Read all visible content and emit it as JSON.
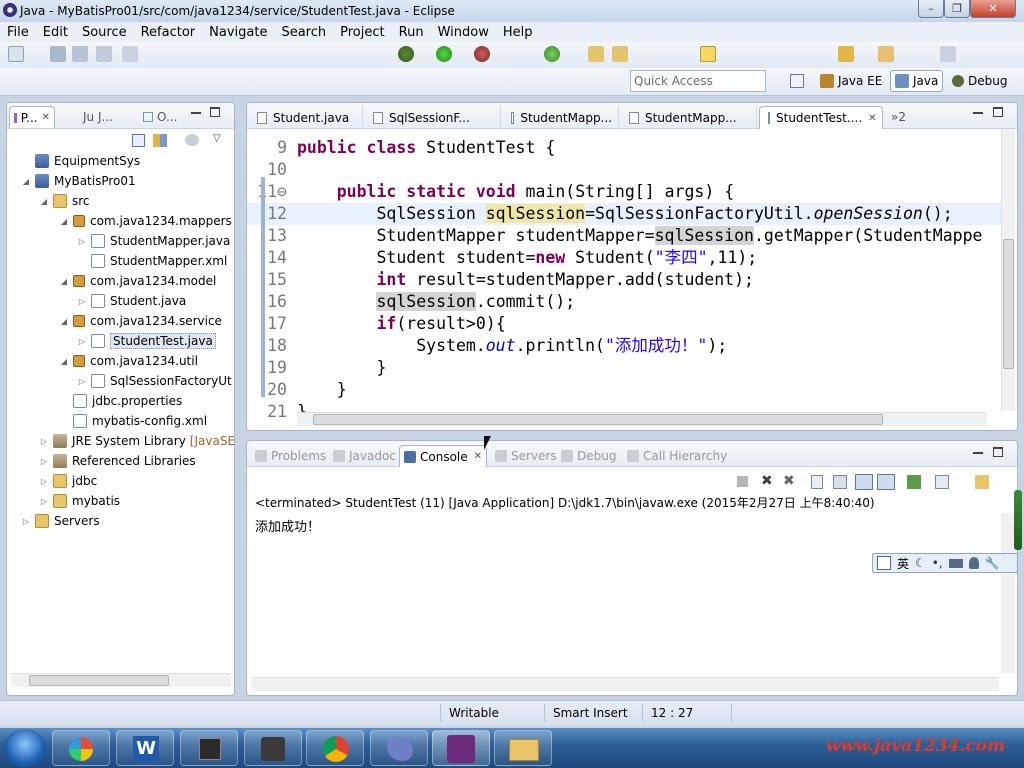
{
  "window": {
    "title": "Java - MyBatisPro01/src/com/java1234/service/StudentTest.java - Eclipse"
  },
  "menu": [
    "File",
    "Edit",
    "Source",
    "Refactor",
    "Navigate",
    "Search",
    "Project",
    "Run",
    "Window",
    "Help"
  ],
  "quick_access": {
    "placeholder": "Quick Access"
  },
  "perspectives": [
    {
      "label": "Java EE",
      "active": false
    },
    {
      "label": "Java",
      "active": true
    },
    {
      "label": "Debug",
      "active": false
    }
  ],
  "package_explorer": {
    "tabs": [
      "P...",
      "Ju J...",
      "O..."
    ],
    "tree": [
      {
        "label": "EquipmentSys",
        "icon": "project-icon",
        "level": 1,
        "twisty": ""
      },
      {
        "label": "MyBatisPro01",
        "icon": "project-icon",
        "level": 1,
        "twisty": "expanded"
      },
      {
        "label": "src",
        "icon": "source-folder-icon",
        "level": 2,
        "twisty": "expanded"
      },
      {
        "label": "com.java1234.mappers",
        "icon": "package-icon",
        "level": 3,
        "twisty": "expanded"
      },
      {
        "label": "StudentMapper.java",
        "icon": "java-file-icon",
        "level": 4,
        "twisty": "collapsed"
      },
      {
        "label": "StudentMapper.xml",
        "icon": "xml-file-icon",
        "level": 4,
        "twisty": ""
      },
      {
        "label": "com.java1234.model",
        "icon": "package-icon",
        "level": 3,
        "twisty": "expanded"
      },
      {
        "label": "Student.java",
        "icon": "java-file-icon",
        "level": 4,
        "twisty": "collapsed"
      },
      {
        "label": "com.java1234.service",
        "icon": "package-icon",
        "level": 3,
        "twisty": "expanded"
      },
      {
        "label": "StudentTest.java",
        "icon": "java-file-icon",
        "level": 4,
        "twisty": "collapsed",
        "selected": true
      },
      {
        "label": "com.java1234.util",
        "icon": "package-icon",
        "level": 3,
        "twisty": "expanded"
      },
      {
        "label": "SqlSessionFactoryUt",
        "icon": "java-file-icon",
        "level": 4,
        "twisty": "collapsed"
      },
      {
        "label": "jdbc.properties",
        "icon": "properties-file-icon",
        "level": 3,
        "twisty": ""
      },
      {
        "label": "mybatis-config.xml",
        "icon": "xml-file-icon",
        "level": 3,
        "twisty": ""
      },
      {
        "label": "JRE System Library",
        "suffix": "[JavaSE",
        "icon": "library-icon",
        "level": 2,
        "twisty": "collapsed"
      },
      {
        "label": "Referenced Libraries",
        "icon": "library-icon",
        "level": 2,
        "twisty": "collapsed"
      },
      {
        "label": "jdbc",
        "icon": "folder-icon",
        "level": 2,
        "twisty": "collapsed"
      },
      {
        "label": "mybatis",
        "icon": "folder-icon",
        "level": 2,
        "twisty": "collapsed"
      },
      {
        "label": "Servers",
        "icon": "folder-icon",
        "level": 1,
        "twisty": "collapsed"
      }
    ]
  },
  "editor": {
    "tabs": [
      {
        "label": "Student.java",
        "active": false
      },
      {
        "label": "SqlSessionF...",
        "active": false
      },
      {
        "label": "StudentMapp...",
        "active": false
      },
      {
        "label": "StudentMapp...",
        "active": false
      },
      {
        "label": "StudentTest....",
        "active": true
      }
    ],
    "overflow": "»2",
    "cursor_line": 12,
    "lines": [
      {
        "n": "9",
        "code": "public class StudentTest {"
      },
      {
        "n": "10",
        "code": ""
      },
      {
        "n": "11⊖",
        "code": "    public static void main(String[] args) {"
      },
      {
        "n": "12",
        "code": "        SqlSession sqlSession=SqlSessionFactoryUtil.openSession();"
      },
      {
        "n": "13",
        "code": "        StudentMapper studentMapper=sqlSession.getMapper(StudentMappe"
      },
      {
        "n": "14",
        "code": "        Student student=new Student(\"李四\",11);"
      },
      {
        "n": "15",
        "code": "        int result=studentMapper.add(student);"
      },
      {
        "n": "16",
        "code": "        sqlSession.commit();"
      },
      {
        "n": "17",
        "code": "        if(result>0){"
      },
      {
        "n": "18",
        "code": "            System.out.println(\"添加成功！\");"
      },
      {
        "n": "19",
        "code": "        }"
      },
      {
        "n": "20",
        "code": "    }"
      },
      {
        "n": "21",
        "code": "}"
      }
    ]
  },
  "bottom_panel": {
    "tabs": [
      {
        "label": "Problems",
        "active": false
      },
      {
        "label": "Javadoc",
        "active": false
      },
      {
        "label": "Console",
        "active": true
      },
      {
        "label": "Servers",
        "active": false
      },
      {
        "label": "Debug",
        "active": false
      },
      {
        "label": "Call Hierarchy",
        "active": false
      }
    ],
    "console_header": "<terminated> StudentTest (11) [Java Application] D:\\jdk1.7\\bin\\javaw.exe (2015年2月27日 上午8:40:40)",
    "console_output": "添加成功！"
  },
  "ime_bar": {
    "lang": "英"
  },
  "status": {
    "writable": "Writable",
    "insert_mode": "Smart Insert",
    "position": "12 : 27"
  },
  "watermark": "www.java1234.com",
  "colors": {
    "keyword": "#7f0055",
    "string": "#2a00ff",
    "field": "#0000c0",
    "selection": "#d4d4d4"
  }
}
